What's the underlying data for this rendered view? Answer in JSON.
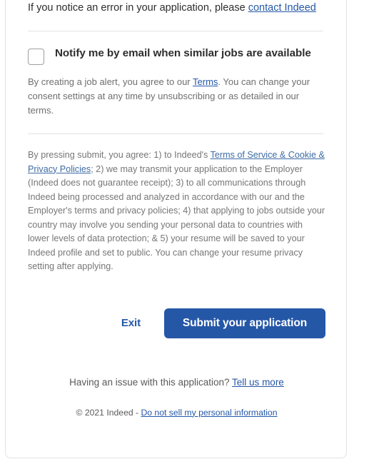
{
  "error_notice": {
    "text_before": "If you notice an error in your application, please ",
    "link_label": "contact Indeed"
  },
  "job_alert": {
    "checkbox_label": "Notify me by email when similar jobs are available",
    "checked": false,
    "consent_before": "By creating a job alert, you agree to our ",
    "consent_link": "Terms",
    "consent_after": ". You can change your consent settings at any time by unsubscribing or as detailed in our terms."
  },
  "legal": {
    "part_1": "By pressing submit, you agree: 1) to Indeed's ",
    "link_label": "Terms of Service & Cookie & Privacy Policies",
    "part_2": "; 2) we may transmit your application to the Employer (Indeed does not guarantee receipt); 3) to all communications through Indeed being processed and analyzed in accordance with our and the Employer's terms and privacy policies; 4) that applying to jobs outside your country may involve you sending your personal data to countries with lower levels of data protection; & 5) your resume will be saved to your Indeed profile and set to public. You can change your resume privacy setting after applying."
  },
  "actions": {
    "exit_label": "Exit",
    "submit_label": "Submit your application"
  },
  "footer": {
    "issue_text": "Having an issue with this application? ",
    "issue_link": "Tell us more",
    "copyright": "© 2021 Indeed - ",
    "privacy_link": "Do not sell my personal information"
  },
  "colors": {
    "brand_blue": "#2557a7",
    "text_dark": "#2d2d2d",
    "text_grey": "#6f6f6f",
    "border_grey": "#e4e2e0"
  }
}
